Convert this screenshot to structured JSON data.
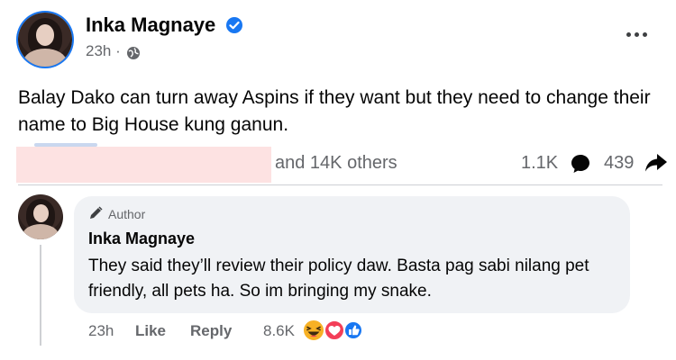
{
  "post": {
    "author": "Inka Magnaye",
    "time": "23h ·",
    "text": "Balay Dako can turn away Aspins if they want but they need to change their name to Big House kung ganun.",
    "reactions_text": "and 14K others",
    "comments_count": "1.1K",
    "shares_count": "439"
  },
  "comment": {
    "badge": "Author",
    "author": "Inka Magnaye",
    "text": "They said they’ll review their policy daw. Basta pag sabi nilang pet friendly, all pets ha. So im bringing my snake.",
    "time": "23h",
    "like_label": "Like",
    "reply_label": "Reply",
    "reactions_count": "8.6K"
  },
  "colors": {
    "verified_blue": "#1877f2",
    "redaction_pink": "#fde2e2",
    "muted_text": "#65676b",
    "bubble_bg": "#f0f2f5"
  },
  "icons": [
    "verified-badge-icon",
    "globe-icon",
    "more-options-icon",
    "comment-bubble-icon",
    "share-arrow-icon",
    "pencil-icon",
    "haha-reaction-icon",
    "love-reaction-icon",
    "like-reaction-icon"
  ]
}
